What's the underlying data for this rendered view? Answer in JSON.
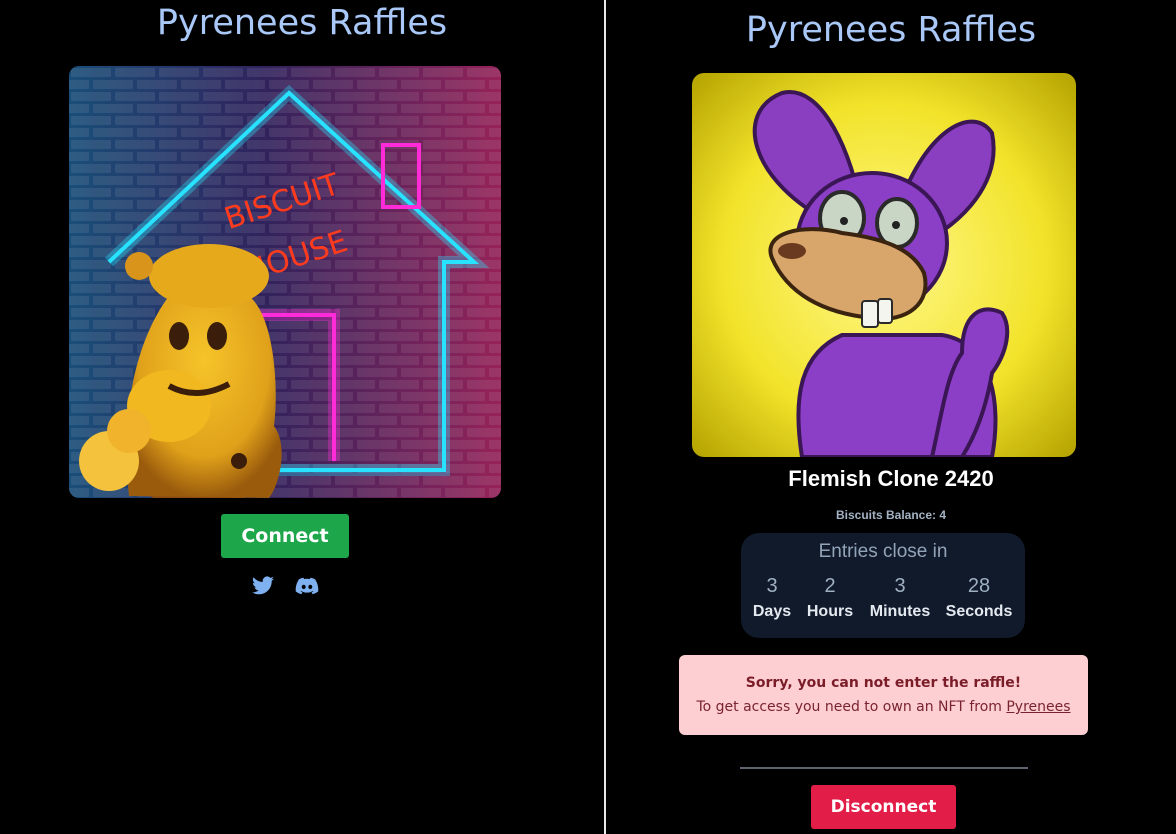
{
  "left": {
    "title": "Pyrenees Raffles",
    "artwork_text": [
      "BISCUIT",
      "HOUSE"
    ],
    "connect_label": "Connect",
    "icons": [
      "twitter-icon",
      "discord-icon"
    ]
  },
  "right": {
    "title": "Pyrenees Raffles",
    "nft_name": "Flemish Clone 2420",
    "balance_label": "Biscuits Balance: 4",
    "countdown": {
      "title": "Entries close in",
      "days": "3",
      "days_label": "Days",
      "hours": "2",
      "hours_label": "Hours",
      "minutes": "3",
      "minutes_label": "Minutes",
      "seconds": "28",
      "seconds_label": "Seconds"
    },
    "alert": {
      "title": "Sorry, you can not enter the raffle!",
      "body_prefix": "To get access you need to own an NFT from ",
      "link": "Pyrenees"
    },
    "disconnect_label": "Disconnect"
  },
  "colors": {
    "title": "#a9c8f7",
    "connect": "#1ea64a",
    "disconnect": "#e11d48",
    "alert_bg": "#fdcfd2",
    "countdown_bg": "#101a2a"
  }
}
